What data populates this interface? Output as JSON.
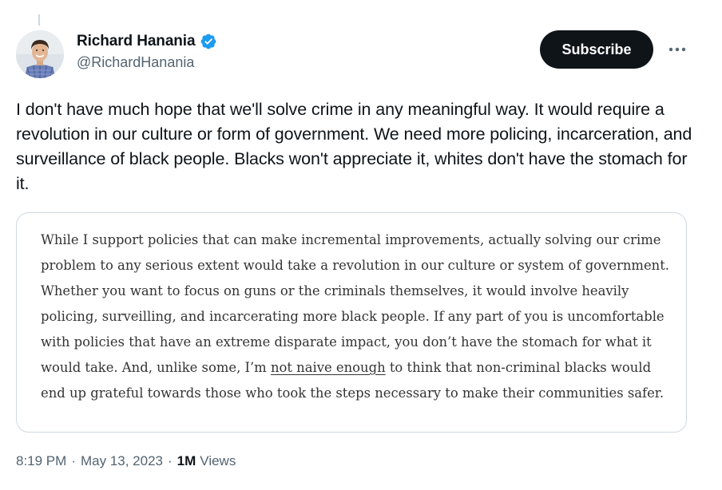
{
  "author": {
    "display_name": "Richard Hanania",
    "handle": "@RichardHanania",
    "verified_icon": "verified-badge-icon",
    "verified_color": "#1d9bf0"
  },
  "actions": {
    "subscribe_label": "Subscribe",
    "more_icon": "more-horizontal-icon"
  },
  "tweet": {
    "text": "I don't have much hope that we'll solve crime in any meaningful way. It would require a revolution in our culture or form of government. We need more policing, incarceration, and surveillance of black people. Blacks won't appreciate it, whites don't have the stomach for it."
  },
  "quote": {
    "before_underline": "While I support policies that can make incremental improvements, actually solving our crime problem to any serious extent would take a revolution in our culture or system of government. Whether you want to focus on guns or the criminals themselves, it would involve heavily policing, surveilling, and incarcerating more black people. If any part of you is uncomfortable with policies that have an extreme disparate impact, you don’t have the stomach for what it would take. And, unlike some, I’m ",
    "underlined": "not naive enough",
    "after_underline": " to think that non-criminal blacks would end up grateful towards those who took the steps necessary to make their communities safer."
  },
  "meta": {
    "time": "8:19 PM",
    "separator": "·",
    "date": "May 13, 2023",
    "views_count": "1M",
    "views_label": "Views"
  },
  "colors": {
    "text_primary": "#0f1419",
    "text_secondary": "#536471",
    "border": "#cfd9de",
    "button_bg": "#0f1419"
  }
}
